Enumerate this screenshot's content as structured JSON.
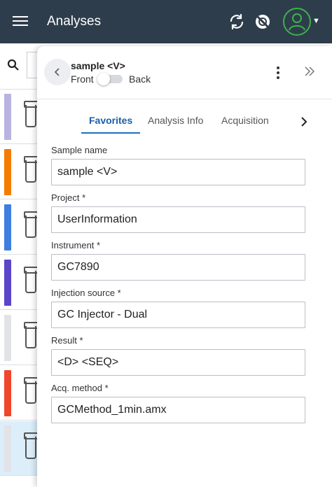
{
  "appbar": {
    "title": "Analyses",
    "icons": [
      "menu-icon",
      "sync-icon",
      "no-signal-icon",
      "user-avatar-icon",
      "caret-down-icon"
    ],
    "avatar_color": "#3cb24a"
  },
  "background_list": {
    "stripe_colors": [
      "#b8b3e0",
      "#f57c00",
      "#3d7fe0",
      "#5b45c8",
      "#e1e3e6",
      "#f0462b",
      "#e1e3e6"
    ]
  },
  "panel": {
    "sample_title": "sample <V>",
    "front_label": "Front",
    "back_label": "Back",
    "toggle_on": false
  },
  "tabs": [
    {
      "label": "Favorites",
      "active": true
    },
    {
      "label": "Analysis Info",
      "active": false
    },
    {
      "label": "Acquisition",
      "active": false
    }
  ],
  "fields": [
    {
      "label": "Sample name",
      "value": "sample <V>"
    },
    {
      "label": "Project *",
      "value": "UserInformation"
    },
    {
      "label": "Instrument *",
      "value": "GC7890"
    },
    {
      "label": "Injection source *",
      "value": "GC Injector - Dual"
    },
    {
      "label": "Result *",
      "value": "<D> <SEQ>"
    },
    {
      "label": "Acq. method *",
      "value": "GCMethod_1min.amx"
    }
  ],
  "colors": {
    "appbar_bg": "#2e3d4b",
    "accent": "#1b6fc2"
  }
}
